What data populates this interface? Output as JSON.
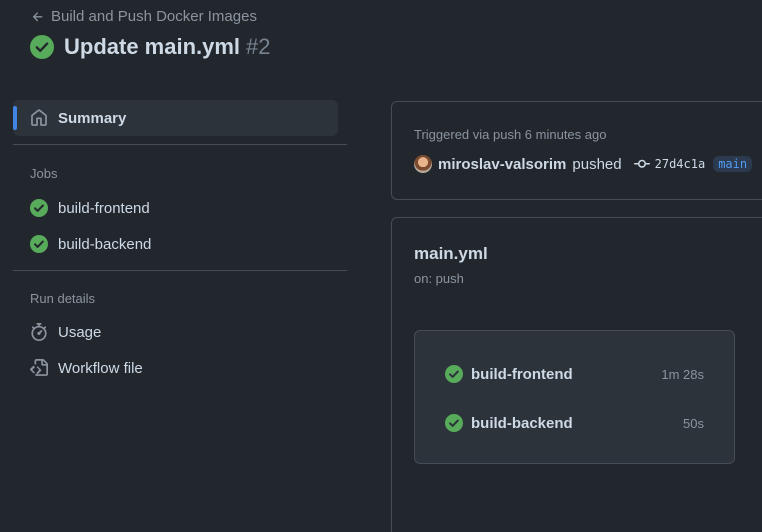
{
  "header": {
    "back_label": "Build and Push Docker Images",
    "title": "Update main.yml",
    "run_number": "#2"
  },
  "sidebar": {
    "summary_label": "Summary",
    "jobs_section": "Jobs",
    "jobs": [
      {
        "label": "build-frontend",
        "status": "success"
      },
      {
        "label": "build-backend",
        "status": "success"
      }
    ],
    "run_details_section": "Run details",
    "usage_label": "Usage",
    "workflow_file_label": "Workflow file"
  },
  "trigger": {
    "label": "Triggered via push 6 minutes ago",
    "actor": "miroslav-valsorim",
    "action": "pushed",
    "commit": "27d4c1a",
    "branch": "main"
  },
  "workflow": {
    "file": "main.yml",
    "event": "on: push",
    "jobs": [
      {
        "name": "build-frontend",
        "duration": "1m 28s",
        "status": "success"
      },
      {
        "name": "build-backend",
        "duration": "50s",
        "status": "success"
      }
    ]
  },
  "colors": {
    "background": "#22272e",
    "success": "#57ab5a",
    "accent": "#4184e4",
    "branch_text": "#539bf5"
  },
  "icons": [
    "arrow-left-icon",
    "check-circle-icon",
    "home-icon",
    "stopwatch-icon",
    "file-code-icon",
    "git-commit-icon"
  ]
}
